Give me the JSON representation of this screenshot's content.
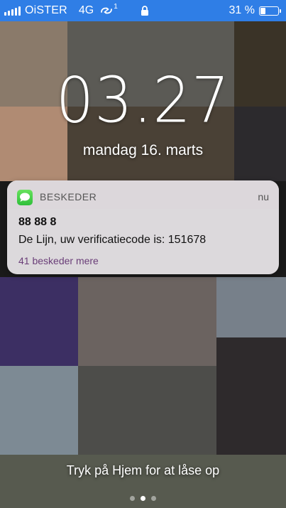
{
  "status_bar": {
    "carrier": "OiSTER",
    "network": "4G",
    "sync_badge": "1",
    "battery_percent": "31 %",
    "battery_level": 0.31,
    "background_color": "#2f7ee6"
  },
  "lock_screen": {
    "time": "03.27",
    "date": "mandag 16. marts",
    "unlock_hint": "Tryk på Hjem for at låse op",
    "pages": 3,
    "active_page": 1
  },
  "notification": {
    "app_name": "BESKEDER",
    "timestamp": "nu",
    "sender": "88 88 8",
    "message": "De Lijn, uw verificatiecode is: 151678",
    "more_link": "41 beskeder mere",
    "app_icon": "messages-icon",
    "accent_color": "#6a3e78"
  },
  "icons": {
    "signal": "signal-bars-icon",
    "sync": "sync-icon",
    "lock": "lock-icon",
    "battery": "battery-icon"
  }
}
